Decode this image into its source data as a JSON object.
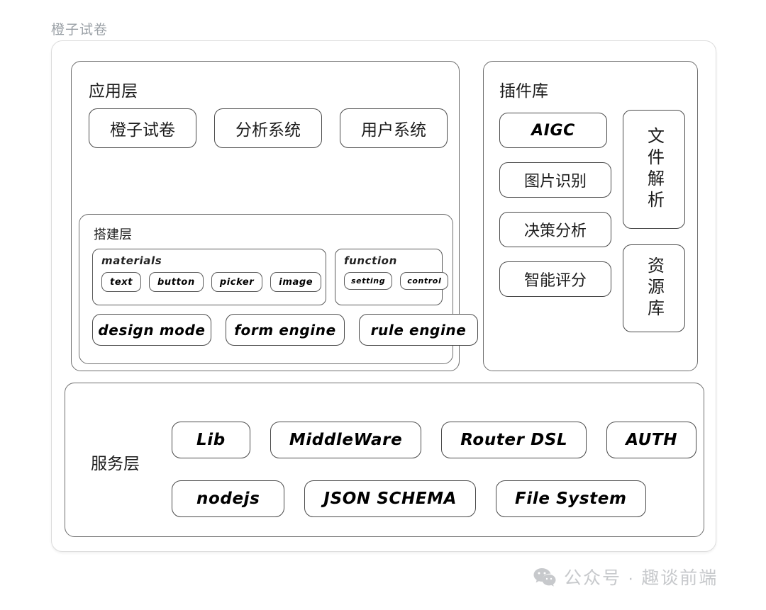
{
  "title": "橙子试卷",
  "app_layer": {
    "title": "应用层",
    "apps": [
      "橙子试卷",
      "分析系统",
      "用户系统"
    ],
    "build_layer": {
      "title": "搭建层",
      "materials": {
        "label": "materials",
        "items": [
          "text",
          "button",
          "picker",
          "image"
        ]
      },
      "function": {
        "label": "function",
        "items": [
          "setting",
          "control"
        ]
      },
      "engines": [
        "design mode",
        "form engine",
        "rule engine"
      ]
    }
  },
  "plugin_layer": {
    "title": "插件库",
    "left_items": [
      "AIGC",
      "图片识别",
      "决策分析",
      "智能评分"
    ],
    "right_items": [
      "文件解析",
      "资源库"
    ]
  },
  "service_layer": {
    "title": "服务层",
    "row1": [
      "Lib",
      "MiddleWare",
      "Router DSL",
      "AUTH"
    ],
    "row2": [
      "nodejs",
      "JSON SCHEMA",
      "File System"
    ]
  },
  "watermark": {
    "icon": "wechat-icon",
    "text": "公众号 · 趣谈前端"
  },
  "colors": {
    "title_gray": "#9aa0a6",
    "box_stroke": "#4a4a4a",
    "soft_stroke": "#dcdcdc",
    "watermark_gray": "#c7c9cc",
    "background": "#ffffff"
  }
}
